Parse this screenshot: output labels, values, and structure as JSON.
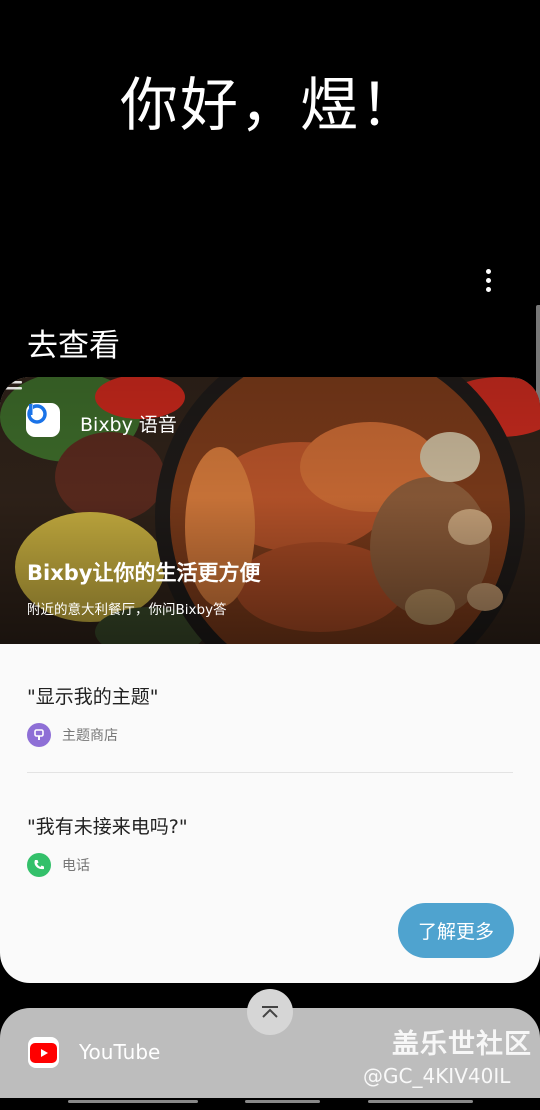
{
  "greeting": "你好，煜！",
  "section_title": "去查看",
  "card": {
    "app_name": "Bixby 语音",
    "hero_title": "Bixby让你的生活更方便",
    "hero_subtitle": "附近的意大利餐厅，你问Bixby答",
    "examples": [
      {
        "query": "\"显示我的主题\"",
        "app": "主题商店",
        "icon": "theme-store-icon",
        "color": "#8e6fd6"
      },
      {
        "query": "\"我有未接来电吗?\"",
        "app": "电话",
        "icon": "phone-icon",
        "color": "#33c06a"
      }
    ],
    "learn_more": "了解更多"
  },
  "next_card": {
    "app_name": "YouTube",
    "icon": "youtube-icon"
  },
  "watermark": {
    "line1": "盖乐世社区",
    "line2": "@GC_4KIV40IL"
  },
  "colors": {
    "accent": "#4fa3cf",
    "bixby_blue": "#1a73e8",
    "youtube_red": "#ff0000"
  }
}
